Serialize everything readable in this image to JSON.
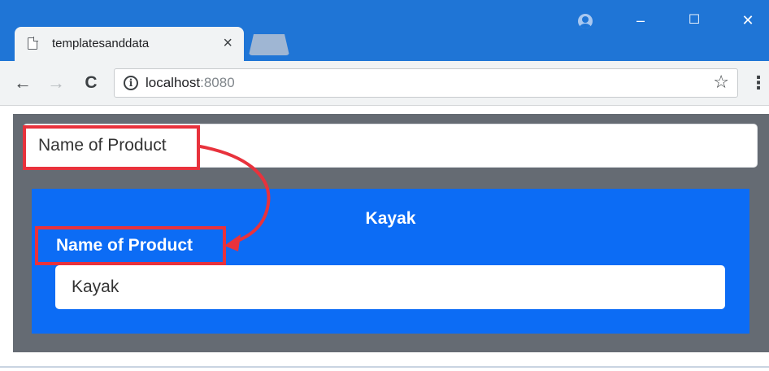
{
  "browser": {
    "tab": {
      "title": "templatesanddata",
      "close_glyph": "×"
    },
    "window_controls": {
      "minimize": "–",
      "maximize": "☐",
      "close": "✕"
    },
    "nav": {
      "back": "←",
      "forward": "→",
      "reload": "C"
    },
    "address": {
      "host": "localhost",
      "port": ":8080"
    },
    "bookmark_glyph": "☆",
    "menu_glyph": "⋮",
    "icons": [
      "page-icon",
      "account-icon",
      "info-icon",
      "star-icon",
      "menu-icon"
    ]
  },
  "app": {
    "name_input_value": "Name of Product",
    "panel": {
      "title": "Kayak",
      "label": "Name of Product",
      "input_value": "Kayak"
    }
  },
  "colors": {
    "titlebar": "#1f75d6",
    "panel": "#0c6cf5",
    "page_background": "#656b73",
    "annotation": "#e8323c"
  }
}
